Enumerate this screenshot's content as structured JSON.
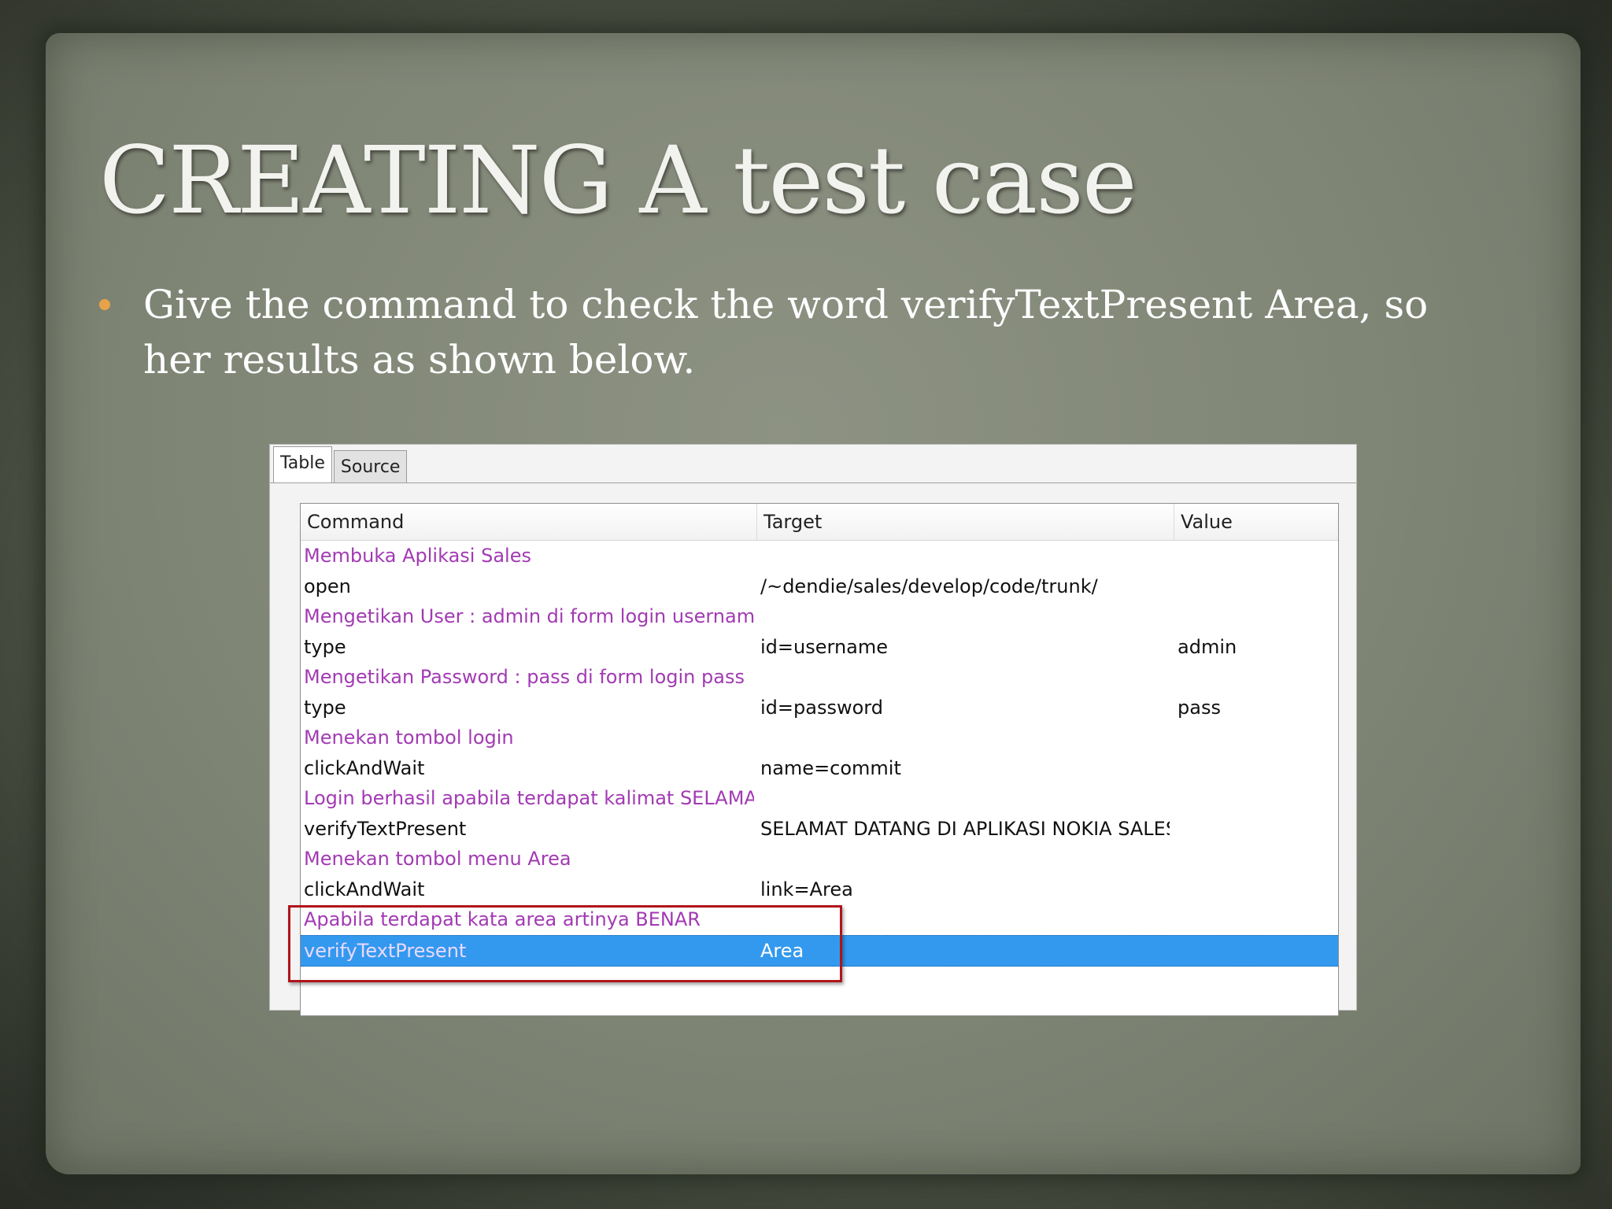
{
  "slide": {
    "title": "CREATING A test case",
    "bullet": "Give the command to check the word verifyTextPresent Area, so her results as shown below."
  },
  "screenshot": {
    "tabs": [
      {
        "label": "Table",
        "active": true
      },
      {
        "label": "Source",
        "active": false
      }
    ],
    "columns": [
      "Command",
      "Target",
      "Value"
    ],
    "rows": [
      {
        "command": "Membuka Aplikasi Sales",
        "target": "",
        "value": "",
        "type": "comment"
      },
      {
        "command": "open",
        "target": "/~dendie/sales/develop/code/trunk/",
        "value": "",
        "type": "command"
      },
      {
        "command": "Mengetikan User : admin di form login username",
        "target": "",
        "value": "",
        "type": "comment"
      },
      {
        "command": "type",
        "target": "id=username",
        "value": "admin",
        "type": "command"
      },
      {
        "command": "Mengetikan Password : pass di form login pass",
        "target": "",
        "value": "",
        "type": "comment"
      },
      {
        "command": "type",
        "target": "id=password",
        "value": "pass",
        "type": "command"
      },
      {
        "command": "Menekan tombol login",
        "target": "",
        "value": "",
        "type": "comment"
      },
      {
        "command": "clickAndWait",
        "target": "name=commit",
        "value": "",
        "type": "command"
      },
      {
        "command": "Login berhasil apabila terdapat kalimat  SELAMA...",
        "target": "",
        "value": "",
        "type": "comment"
      },
      {
        "command": "verifyTextPresent",
        "target": "SELAMAT DATANG DI APLIKASI NOKIA SALES",
        "value": "",
        "type": "command"
      },
      {
        "command": "Menekan tombol menu Area",
        "target": "",
        "value": "",
        "type": "comment"
      },
      {
        "command": "clickAndWait",
        "target": "link=Area",
        "value": "",
        "type": "command"
      },
      {
        "command": "Apabila terdapat kata area artinya BENAR",
        "target": "",
        "value": "",
        "type": "comment"
      },
      {
        "command": "verifyTextPresent",
        "target": "Area",
        "value": "",
        "type": "selected"
      }
    ]
  },
  "colors": {
    "comment_text": "#a23ab3",
    "selection": "#3399ee",
    "highlight_box": "#b0141a",
    "bullet": "#e8a24a"
  }
}
